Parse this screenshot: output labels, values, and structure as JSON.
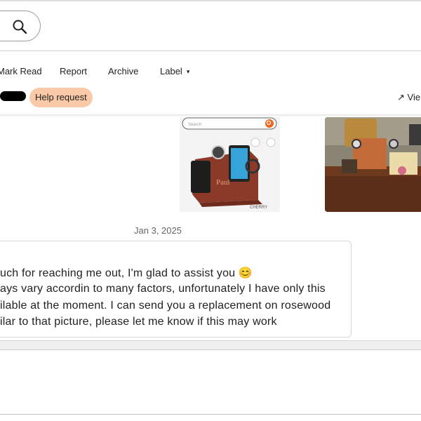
{
  "search": {
    "icon": "search-icon"
  },
  "toolbar": {
    "mark_read": "Mark Read",
    "report": "Report",
    "archive": "Archive",
    "label": "Label",
    "label_caret": "▾"
  },
  "conversation": {
    "badge": "Help request",
    "view_link": "↗ Vie"
  },
  "images": {
    "product_search_placeholder": "Search",
    "product_caption": "CHERRY",
    "product_name": "Paul"
  },
  "message": {
    "date": "Jan 3, 2025",
    "lines": [
      "uch for reaching me out, I'm glad to assist you 😊",
      "ays vary accordin to many factors, unfortunately I have only this",
      "ilable at the moment. I can send you a replacement on rosewood",
      "ilar to that picture, please let me know if this may work"
    ]
  },
  "colors": {
    "badge_bg": "#f9c9a8",
    "accent_orange": "#f1641e"
  }
}
